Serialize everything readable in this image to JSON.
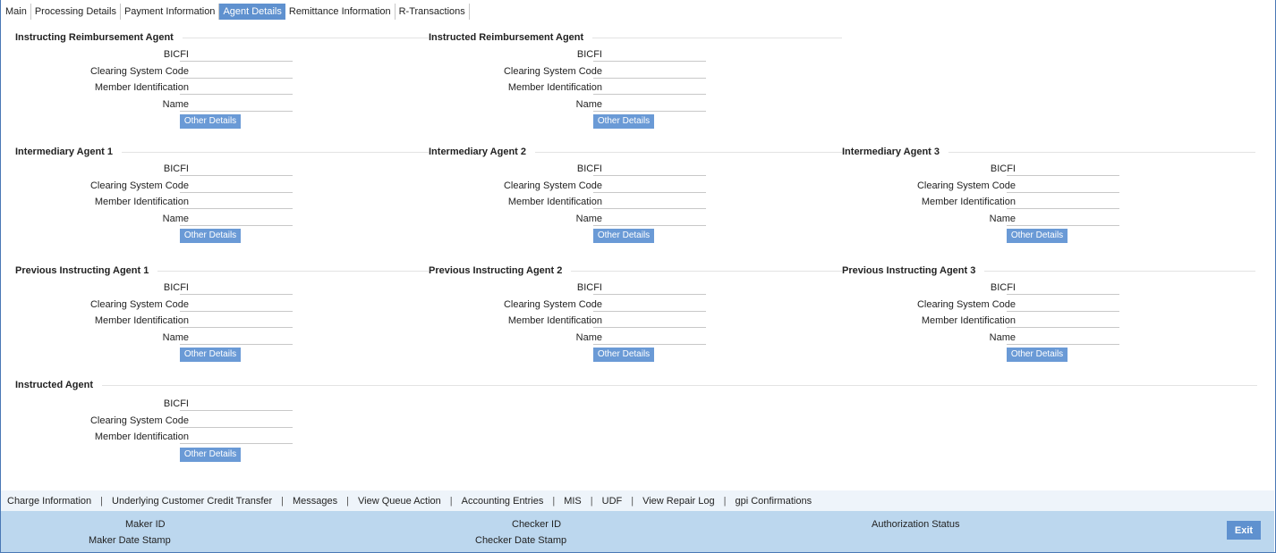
{
  "tabs": [
    "Main",
    "Processing Details",
    "Payment Information",
    "Agent Details",
    "Remittance Information",
    "R-Transactions"
  ],
  "active_tab": "Agent Details",
  "labels": {
    "bicfi": "BICFI",
    "clearing": "Clearing System Code",
    "member": "Member Identification",
    "name": "Name",
    "other_details": "Other Details"
  },
  "sections": {
    "instructing_reimbursement_agent": "Instructing Reimbursement Agent",
    "instructed_reimbursement_agent": "Instructed Reimbursement Agent",
    "intermediary_agent_1": "Intermediary Agent 1",
    "intermediary_agent_2": "Intermediary Agent 2",
    "intermediary_agent_3": "Intermediary Agent 3",
    "previous_instructing_agent_1": "Previous Instructing Agent 1",
    "previous_instructing_agent_2": "Previous Instructing Agent 2",
    "previous_instructing_agent_3": "Previous Instructing Agent 3",
    "instructed_agent": "Instructed Agent"
  },
  "links": [
    "Charge Information",
    "Underlying Customer Credit Transfer",
    "Messages",
    "View Queue Action",
    "Accounting Entries",
    "MIS",
    "UDF",
    "View Repair Log",
    "gpi Confirmations"
  ],
  "footer": {
    "maker_id": "Maker ID",
    "maker_date_stamp": "Maker Date Stamp",
    "checker_id": "Checker ID",
    "checker_date_stamp": "Checker Date Stamp",
    "authorization_status": "Authorization Status",
    "exit": "Exit"
  },
  "colors": {
    "active_tab": "#5f91cf",
    "button": "#6a9ad6",
    "footer": "#bcd7ee",
    "link_bar": "#eef4fa"
  }
}
